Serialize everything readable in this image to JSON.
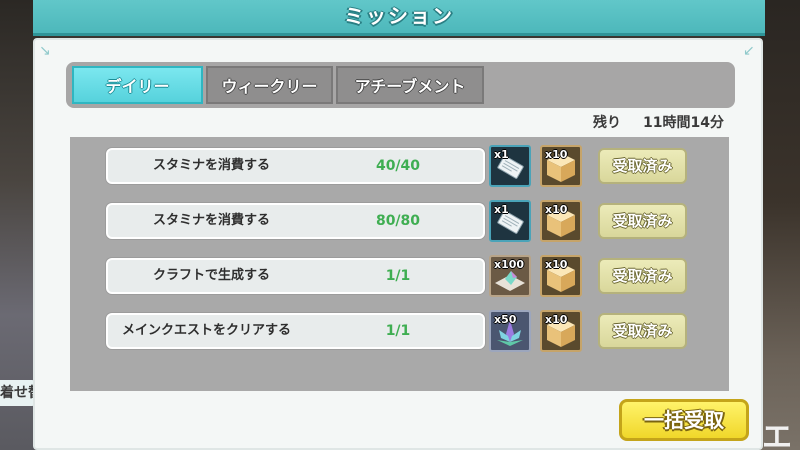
{
  "header": {
    "title": "ミッション"
  },
  "background": {
    "left_sign_text": "着せ替",
    "right_sign_text": "エ"
  },
  "tabs": [
    {
      "label": "デイリー",
      "active": true
    },
    {
      "label": "ウィークリー",
      "active": false
    },
    {
      "label": "アチーブメント",
      "active": false
    }
  ],
  "remaining": {
    "label": "残り",
    "time": "11時間14分"
  },
  "missions": [
    {
      "title": "スタミナを消費する",
      "progress": "40/40",
      "rewards": [
        {
          "icon": "ticket-icon",
          "qty": "x1"
        },
        {
          "icon": "cube-icon",
          "qty": "x10"
        }
      ],
      "button": "受取済み"
    },
    {
      "title": "スタミナを消費する",
      "progress": "80/80",
      "rewards": [
        {
          "icon": "ticket-icon",
          "qty": "x1"
        },
        {
          "icon": "cube-icon",
          "qty": "x10"
        }
      ],
      "button": "受取済み"
    },
    {
      "title": "クラフトで生成する",
      "progress": "1/1",
      "rewards": [
        {
          "icon": "crystal-shard-icon",
          "qty": "x100"
        },
        {
          "icon": "cube-icon",
          "qty": "x10"
        }
      ],
      "button": "受取済み"
    },
    {
      "title": "メインクエストをクリアする",
      "progress": "1/1",
      "rewards": [
        {
          "icon": "lotus-crystal-icon",
          "qty": "x50"
        },
        {
          "icon": "cube-icon",
          "qty": "x10"
        }
      ],
      "button": "受取済み"
    }
  ],
  "bulk_claim": {
    "label": "一括受取"
  },
  "colors": {
    "accent": "#56d2dc",
    "header": "#4db8bb",
    "progress_text": "#3fae52",
    "claim_button": "#d9d79b",
    "bulk_button": "#f0d72a"
  }
}
